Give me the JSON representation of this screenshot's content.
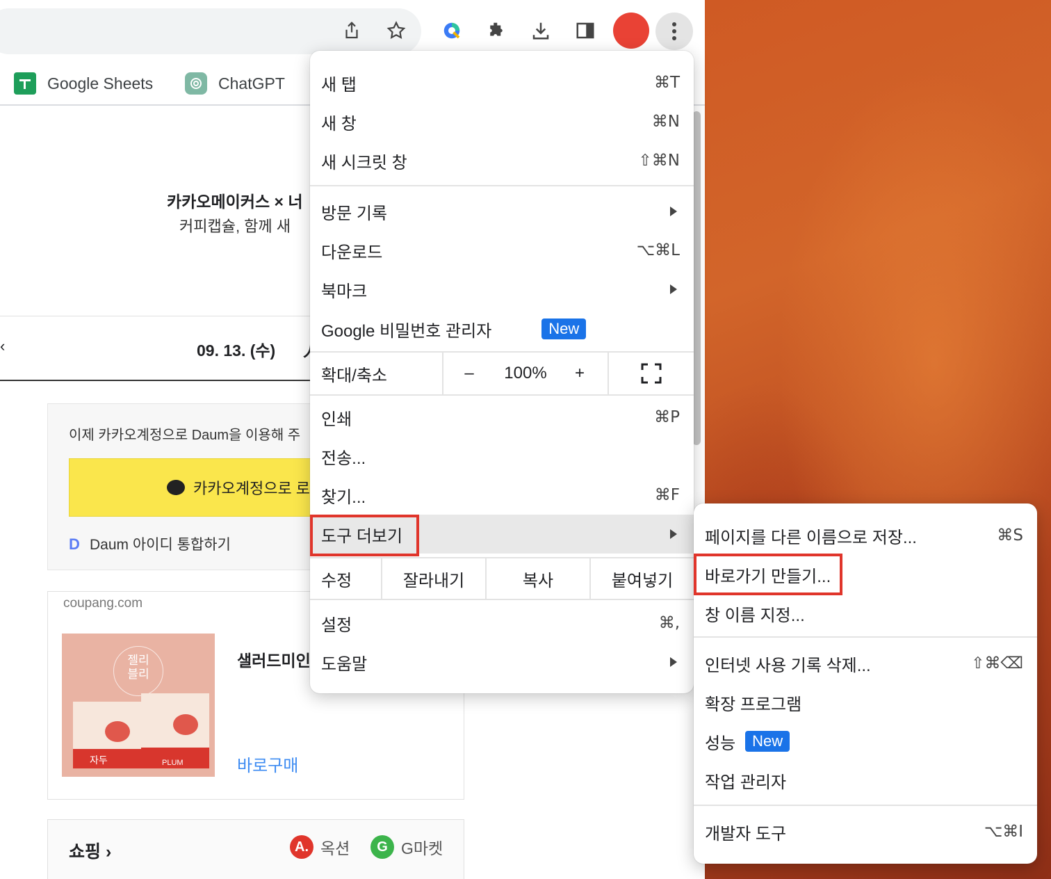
{
  "bookmarks": [
    {
      "label": "Google Sheets",
      "icon": "google-sheets-icon"
    },
    {
      "label": "ChatGPT",
      "icon": "chatgpt-icon"
    }
  ],
  "page": {
    "headline": "카카오메이커스 × 너",
    "subline": "커피캡슐, 함께 새",
    "date": "09. 13. (수)",
    "date_suffix": "人",
    "login_message": "이제 카카오계정으로 Daum을 이용해 주",
    "kakao_button": "카카오계정으로 로",
    "daum_link": "Daum 아이디 통합하기",
    "ad_source": "coupang.com",
    "ad_title": "샐러드미인",
    "ad_buy": "바로구매",
    "ad_image_text": {
      "jelly": "젤리",
      "belly": "블리",
      "plum_kr": "자두",
      "plum_en": "PLUM"
    },
    "shopping_title": "쇼핑",
    "shop_links": [
      {
        "label": "옥션",
        "logo": "A.",
        "color": "#e0352b"
      },
      {
        "label": "G마켓",
        "logo": "G",
        "color": "#3cb44b"
      }
    ]
  },
  "menu": {
    "new_tab": {
      "label": "새 탭",
      "shortcut": "⌘T"
    },
    "new_window": {
      "label": "새 창",
      "shortcut": "⌘N"
    },
    "incognito": {
      "label": "새 시크릿 창",
      "shortcut": "⇧⌘N"
    },
    "history": {
      "label": "방문 기록"
    },
    "downloads": {
      "label": "다운로드",
      "shortcut": "⌥⌘L"
    },
    "bookmarks": {
      "label": "북마크"
    },
    "password_manager": {
      "label": "Google 비밀번호 관리자",
      "badge": "New"
    },
    "zoom": {
      "label": "확대/축소",
      "minus": "–",
      "value": "100%",
      "plus": "+"
    },
    "print": {
      "label": "인쇄",
      "shortcut": "⌘P"
    },
    "cast": {
      "label": "전송..."
    },
    "find": {
      "label": "찾기...",
      "shortcut": "⌘F"
    },
    "more_tools": {
      "label": "도구 더보기"
    },
    "edit": {
      "label": "수정",
      "cut": "잘라내기",
      "copy": "복사",
      "paste": "붙여넣기"
    },
    "settings": {
      "label": "설정",
      "shortcut": "⌘,"
    },
    "help": {
      "label": "도움말"
    }
  },
  "submenu": {
    "save_page": {
      "label": "페이지를 다른 이름으로 저장...",
      "shortcut": "⌘S"
    },
    "create_shortcut": {
      "label": "바로가기 만들기..."
    },
    "name_window": {
      "label": "창 이름 지정..."
    },
    "clear_data": {
      "label": "인터넷 사용 기록 삭제...",
      "shortcut": "⇧⌘⌫"
    },
    "extensions": {
      "label": "확장 프로그램"
    },
    "performance": {
      "label": "성능",
      "badge": "New"
    },
    "task_manager": {
      "label": "작업 관리자"
    },
    "dev_tools": {
      "label": "개발자 도구",
      "shortcut": "⌥⌘I"
    }
  },
  "colors": {
    "highlight_box": "#e0352b",
    "new_badge": "#1a73e8",
    "profile": "#e94235",
    "kakao_yellow": "#fae64c"
  }
}
